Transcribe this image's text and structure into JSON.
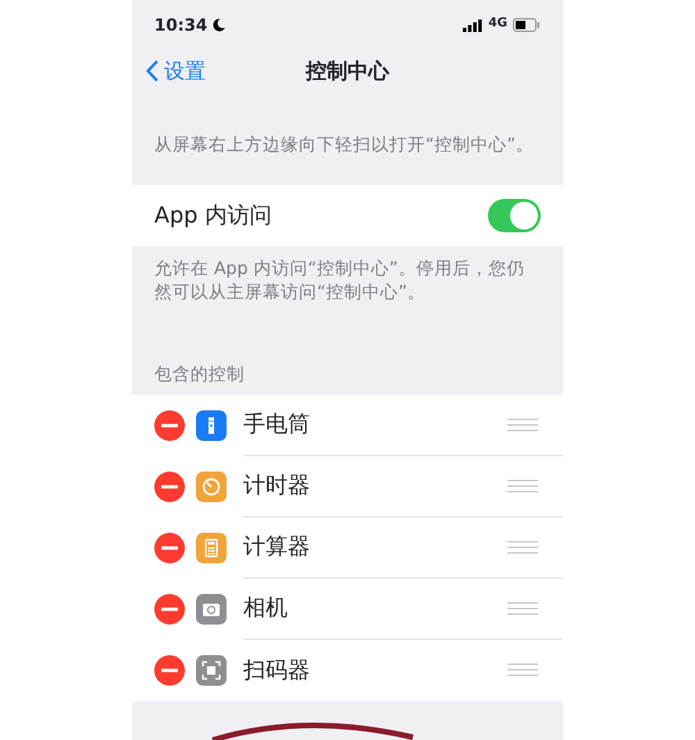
{
  "status_bar": {
    "time": "10:34",
    "network": "4G"
  },
  "nav": {
    "back": "设置",
    "title": "控制中心"
  },
  "intro": "从屏幕右上方边缘向下轻扫以打开“控制中心”。",
  "access": {
    "label": "App 内访问",
    "on": true
  },
  "access_note": "允许在 App 内访问“控制中心”。停用后，您仍然可以从主屏幕访问“控制中心”。",
  "section_header": "包含的控制",
  "controls": [
    {
      "label": "手电筒",
      "kind": "flashlight",
      "color": "#1a7cf5"
    },
    {
      "label": "计时器",
      "kind": "timer",
      "color": "#f2a33a"
    },
    {
      "label": "计算器",
      "kind": "calculator",
      "color": "#f2a33a"
    },
    {
      "label": "相机",
      "kind": "camera",
      "color": "#8e8e93"
    },
    {
      "label": "扫码器",
      "kind": "scanner",
      "color": "#8e8e93"
    }
  ]
}
